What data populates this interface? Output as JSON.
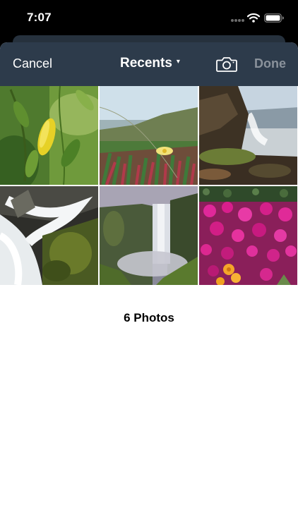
{
  "status_bar": {
    "time": "7:07",
    "icons": [
      "cellular-signal-icon",
      "wifi-icon",
      "battery-icon"
    ]
  },
  "nav": {
    "cancel_label": "Cancel",
    "title": "Recents",
    "title_caret": "▾",
    "camera_icon": "camera-icon",
    "done_label": "Done"
  },
  "colors": {
    "nav_background": "#2d3b4b",
    "done_disabled": "#8a929b",
    "sheet_background": "#ffffff"
  },
  "photos": [
    {
      "subject": "leaves"
    },
    {
      "subject": "coastal-flower"
    },
    {
      "subject": "waterfall-cliff"
    },
    {
      "subject": "cascade"
    },
    {
      "subject": "tall-waterfall"
    },
    {
      "subject": "pink-flowers"
    }
  ],
  "footer": {
    "photo_count": "6 Photos"
  }
}
